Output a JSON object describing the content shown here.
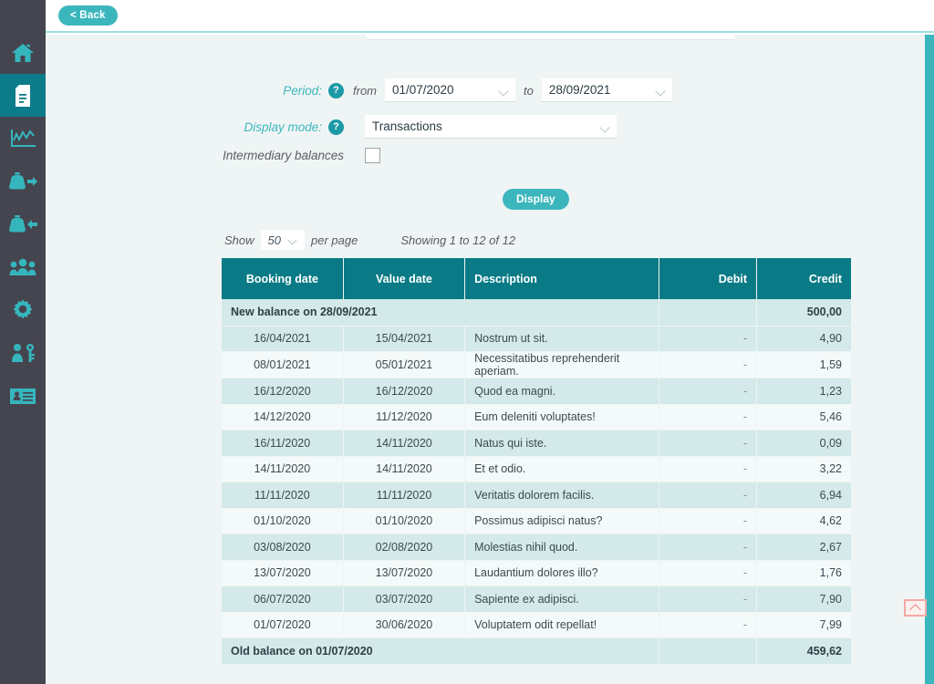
{
  "sidebar": {
    "items": [
      {
        "name": "home",
        "icon": "home-icon",
        "active": false
      },
      {
        "name": "documents",
        "icon": "document-icon",
        "active": true
      },
      {
        "name": "statistics",
        "icon": "chart-line-icon",
        "active": false
      },
      {
        "name": "outgoing",
        "icon": "purse-out-icon",
        "active": false
      },
      {
        "name": "incoming",
        "icon": "purse-in-icon",
        "active": false
      },
      {
        "name": "members",
        "icon": "people-icon",
        "active": false
      },
      {
        "name": "settings",
        "icon": "gear-icon",
        "active": false
      },
      {
        "name": "permissions",
        "icon": "user-key-icon",
        "active": false
      },
      {
        "name": "contacts",
        "icon": "id-card-icon",
        "active": false
      }
    ]
  },
  "topbar": {
    "back_label": "< Back"
  },
  "form": {
    "period_label": "Period:",
    "period_help": "?",
    "from_label": "from",
    "from_value": "01/07/2020",
    "to_label": "to",
    "to_value": "28/09/2021",
    "display_mode_label": "Display mode:",
    "display_mode_help": "?",
    "display_mode_value": "Transactions",
    "display_mode_options": [
      "Transactions"
    ],
    "intermediary_label": "Intermediary balances",
    "intermediary_checked": false,
    "display_button": "Display"
  },
  "paging": {
    "show_label": "Show",
    "per_page_value": "50",
    "per_page_options": [
      "50"
    ],
    "per_page_label": "per page",
    "showing_text": "Showing 1 to 12 of 12"
  },
  "table": {
    "columns": [
      "Booking date",
      "Value date",
      "Description",
      "Debit",
      "Credit"
    ],
    "new_balance": {
      "label": "New balance on 28/09/2021",
      "debit": "",
      "credit": "500,00"
    },
    "rows": [
      {
        "booking_date": "16/04/2021",
        "value_date": "15/04/2021",
        "description": "Nostrum ut sit.",
        "debit": "-",
        "credit": "4,90"
      },
      {
        "booking_date": "08/01/2021",
        "value_date": "05/01/2021",
        "description": "Necessitatibus reprehenderit aperiam.",
        "debit": "-",
        "credit": "1,59"
      },
      {
        "booking_date": "16/12/2020",
        "value_date": "16/12/2020",
        "description": "Quod ea magni.",
        "debit": "-",
        "credit": "1,23"
      },
      {
        "booking_date": "14/12/2020",
        "value_date": "11/12/2020",
        "description": "Eum deleniti voluptates!",
        "debit": "-",
        "credit": "5,46"
      },
      {
        "booking_date": "16/11/2020",
        "value_date": "14/11/2020",
        "description": "Natus qui iste.",
        "debit": "-",
        "credit": "0,09"
      },
      {
        "booking_date": "14/11/2020",
        "value_date": "14/11/2020",
        "description": "Et et odio.",
        "debit": "-",
        "credit": "3,22"
      },
      {
        "booking_date": "11/11/2020",
        "value_date": "11/11/2020",
        "description": "Veritatis dolorem facilis.",
        "debit": "-",
        "credit": "6,94"
      },
      {
        "booking_date": "01/10/2020",
        "value_date": "01/10/2020",
        "description": "Possimus adipisci natus?",
        "debit": "-",
        "credit": "4,62"
      },
      {
        "booking_date": "03/08/2020",
        "value_date": "02/08/2020",
        "description": "Molestias nihil quod.",
        "debit": "-",
        "credit": "2,67"
      },
      {
        "booking_date": "13/07/2020",
        "value_date": "13/07/2020",
        "description": "Laudantium dolores illo?",
        "debit": "-",
        "credit": "1,76"
      },
      {
        "booking_date": "06/07/2020",
        "value_date": "03/07/2020",
        "description": "Sapiente ex adipisci.",
        "debit": "-",
        "credit": "7,90"
      },
      {
        "booking_date": "01/07/2020",
        "value_date": "30/06/2020",
        "description": "Voluptatem odit repellat!",
        "debit": "-",
        "credit": "7,99"
      }
    ],
    "old_balance": {
      "label": "Old balance on 01/07/2020",
      "debit": "",
      "credit": "459,62"
    }
  },
  "scroll_top": {
    "icon": "chevron-up-icon"
  },
  "colors": {
    "sidebar_bg": "#45454f",
    "sidebar_icon": "#35b6bd",
    "sidebar_active": "#0d7c8a",
    "accent": "#3cb6bd",
    "table_header": "#0a7b86",
    "row_even": "#d4e9e9",
    "row_odd": "#f3faf9",
    "content_bg": "#eff5f4",
    "scroll_top_border": "#f2a9a4"
  }
}
